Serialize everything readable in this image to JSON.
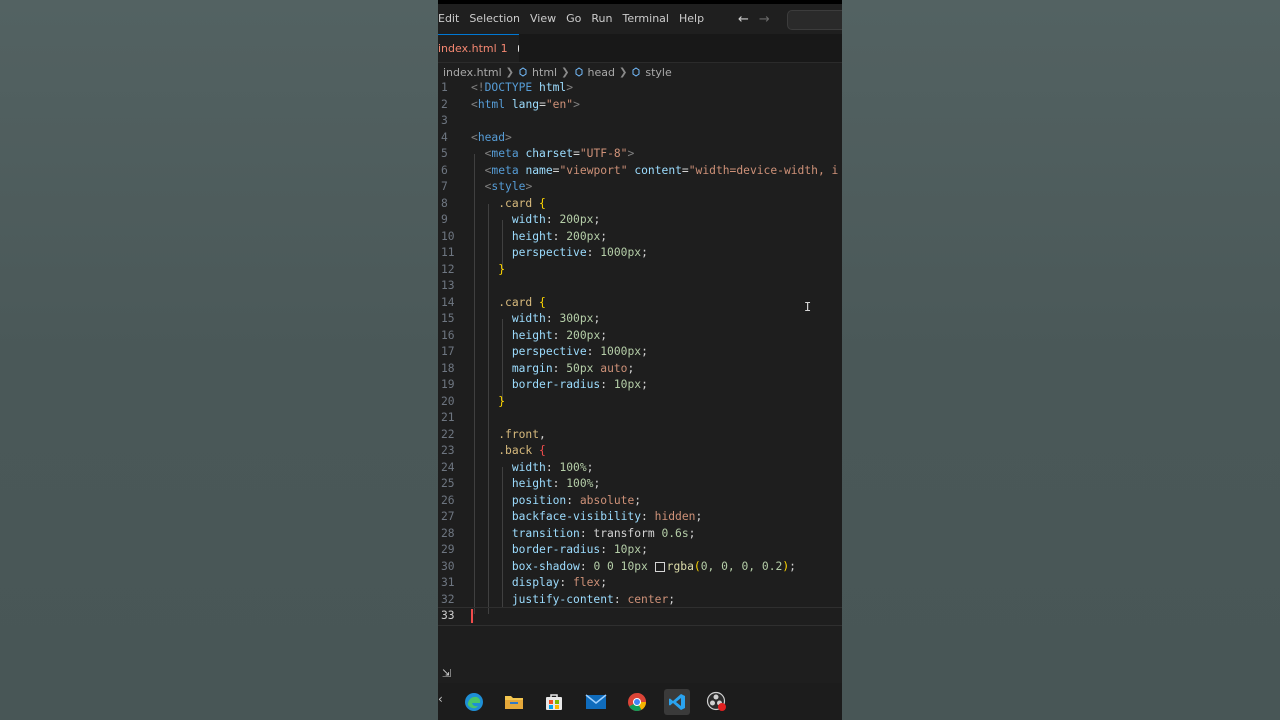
{
  "menu": {
    "items": [
      "Edit",
      "Selection",
      "View",
      "Go",
      "Run",
      "Terminal",
      "Help"
    ],
    "back_icon": "arrow-left-icon",
    "forward_icon": "arrow-right-icon"
  },
  "tab": {
    "filename": "index.html",
    "problems": "1",
    "dirty_icon": "unsaved-dot-icon"
  },
  "breadcrumb": {
    "file": "index.html",
    "items": [
      "html",
      "head",
      "style"
    ]
  },
  "editor": {
    "line_numbers": [
      "1",
      "2",
      "3",
      "4",
      "5",
      "6",
      "7",
      "8",
      "9",
      "10",
      "11",
      "12",
      "13",
      "14",
      "15",
      "16",
      "17",
      "18",
      "19",
      "20",
      "21",
      "22",
      "23",
      "24",
      "25",
      "26",
      "27",
      "28",
      "29",
      "30",
      "31",
      "32",
      "33"
    ],
    "active_line": "33"
  },
  "taskbar": {
    "apps": [
      "edge-icon",
      "file-explorer-icon",
      "store-icon",
      "mail-icon",
      "chrome-icon",
      "vscode-icon",
      "obs-icon"
    ],
    "active_app": "vscode-icon"
  },
  "colors": {
    "editor_bg": "#1e1e1e",
    "accent": "#0078d4",
    "tab_error": "#f48771"
  }
}
